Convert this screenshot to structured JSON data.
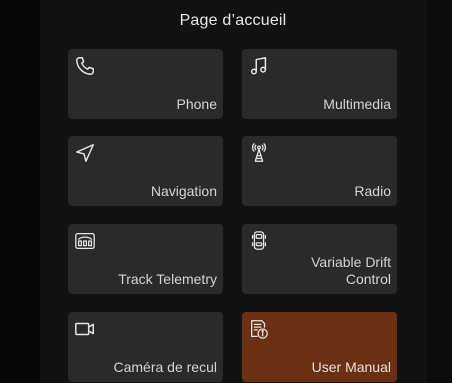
{
  "header": {
    "title": "Page d’accueil"
  },
  "tiles": [
    {
      "label": "Phone",
      "icon": "phone-icon"
    },
    {
      "label": "Multimedia",
      "icon": "music-note-icon"
    },
    {
      "label": "Navigation",
      "icon": "navigation-arrow-icon"
    },
    {
      "label": "Radio",
      "icon": "radio-tower-icon"
    },
    {
      "label": "Track Telemetry",
      "icon": "telemetry-gauge-icon"
    },
    {
      "label": "Variable Drift Control",
      "icon": "drift-car-icon"
    },
    {
      "label": "Caméra de recul",
      "icon": "camera-icon"
    },
    {
      "label": "User Manual",
      "icon": "manual-info-icon",
      "highlighted": true
    }
  ],
  "colors": {
    "background": "#070707",
    "panel": "#121212",
    "tile": "#2a2a2a",
    "highlight": "#6b2f13",
    "text": "#d4d4d4"
  }
}
